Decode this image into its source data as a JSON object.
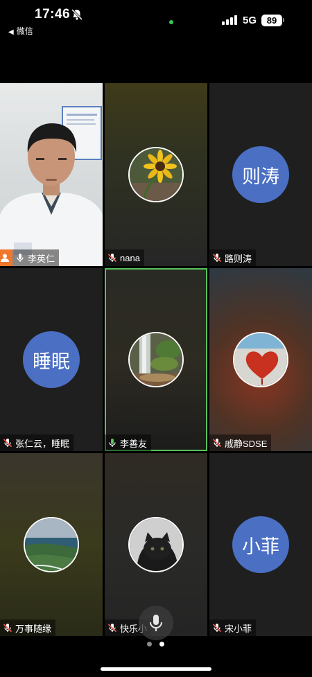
{
  "status_bar": {
    "time": "17:46",
    "back_label": "微信",
    "network": "5G",
    "battery": "89"
  },
  "participants": [
    {
      "name": "李英仁",
      "type": "video",
      "host": true,
      "mic": "on"
    },
    {
      "name": "nana",
      "type": "photo",
      "photo": "sunflower",
      "mic": "muted"
    },
    {
      "name": "路则涛",
      "type": "initials",
      "initials": "则涛",
      "mic": "muted"
    },
    {
      "name": "张仁云，睡眠",
      "type": "initials",
      "initials": "睡眠",
      "mic": "muted"
    },
    {
      "name": "李善友",
      "type": "photo",
      "photo": "waterfall",
      "mic": "speaking",
      "active": true
    },
    {
      "name": "戚静SDSE",
      "type": "photo",
      "photo": "heart",
      "mic": "muted"
    },
    {
      "name": "万事随缘",
      "type": "photo",
      "photo": "coast",
      "mic": "muted"
    },
    {
      "name": "快乐小",
      "type": "photo",
      "photo": "cat",
      "mic": "muted"
    },
    {
      "name": "宋小菲",
      "type": "initials",
      "initials": "小菲",
      "mic": "muted"
    }
  ],
  "colors": {
    "initials_bg": "#4a6fc3",
    "active_border": "#55c45a",
    "host_badge": "#f0772b",
    "speaking_mic": "#55c45a",
    "muted_mic": "#ff5a4e"
  },
  "pagination": {
    "pages": 2,
    "current": 2
  }
}
